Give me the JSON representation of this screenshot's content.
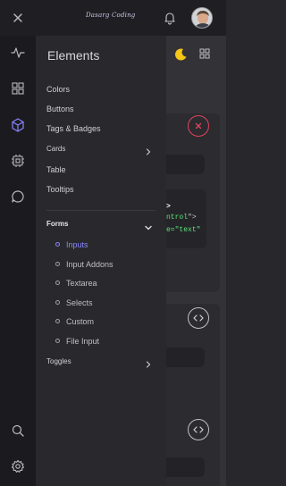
{
  "topbar": {
    "brand": "Dasarg Coding",
    "icons": [
      "close-icon",
      "bell-icon",
      "avatar"
    ]
  },
  "rail": {
    "icons": [
      "activity-icon",
      "grid-icon",
      "cube-icon",
      "chip-icon",
      "chat-icon",
      "search-icon",
      "gear-icon"
    ]
  },
  "menu": {
    "title": "Elements",
    "items": {
      "colors": "Colors",
      "buttons": "Buttons",
      "tags": "Tags & Badges",
      "cards": "Cards",
      "table": "Table",
      "tooltips": "Tooltips",
      "forms": "Forms",
      "toggles": "Toggles"
    },
    "forms_sub": {
      "inputs": "Inputs",
      "addons": "Input Addons",
      "textarea": "Textarea",
      "selects": "Selects",
      "custom": "Custom",
      "file": "File Input"
    }
  },
  "main": {
    "code": {
      "line1": ">",
      "line2_a": "ntrol",
      "line2_b": "\">",
      "line3_a": "e=",
      "line3_b": "\"text\""
    }
  },
  "colors": {
    "accent": "#8a85ff",
    "danger": "#e0455d",
    "moon": "#f5c518",
    "code_green": "#5ee37a"
  }
}
